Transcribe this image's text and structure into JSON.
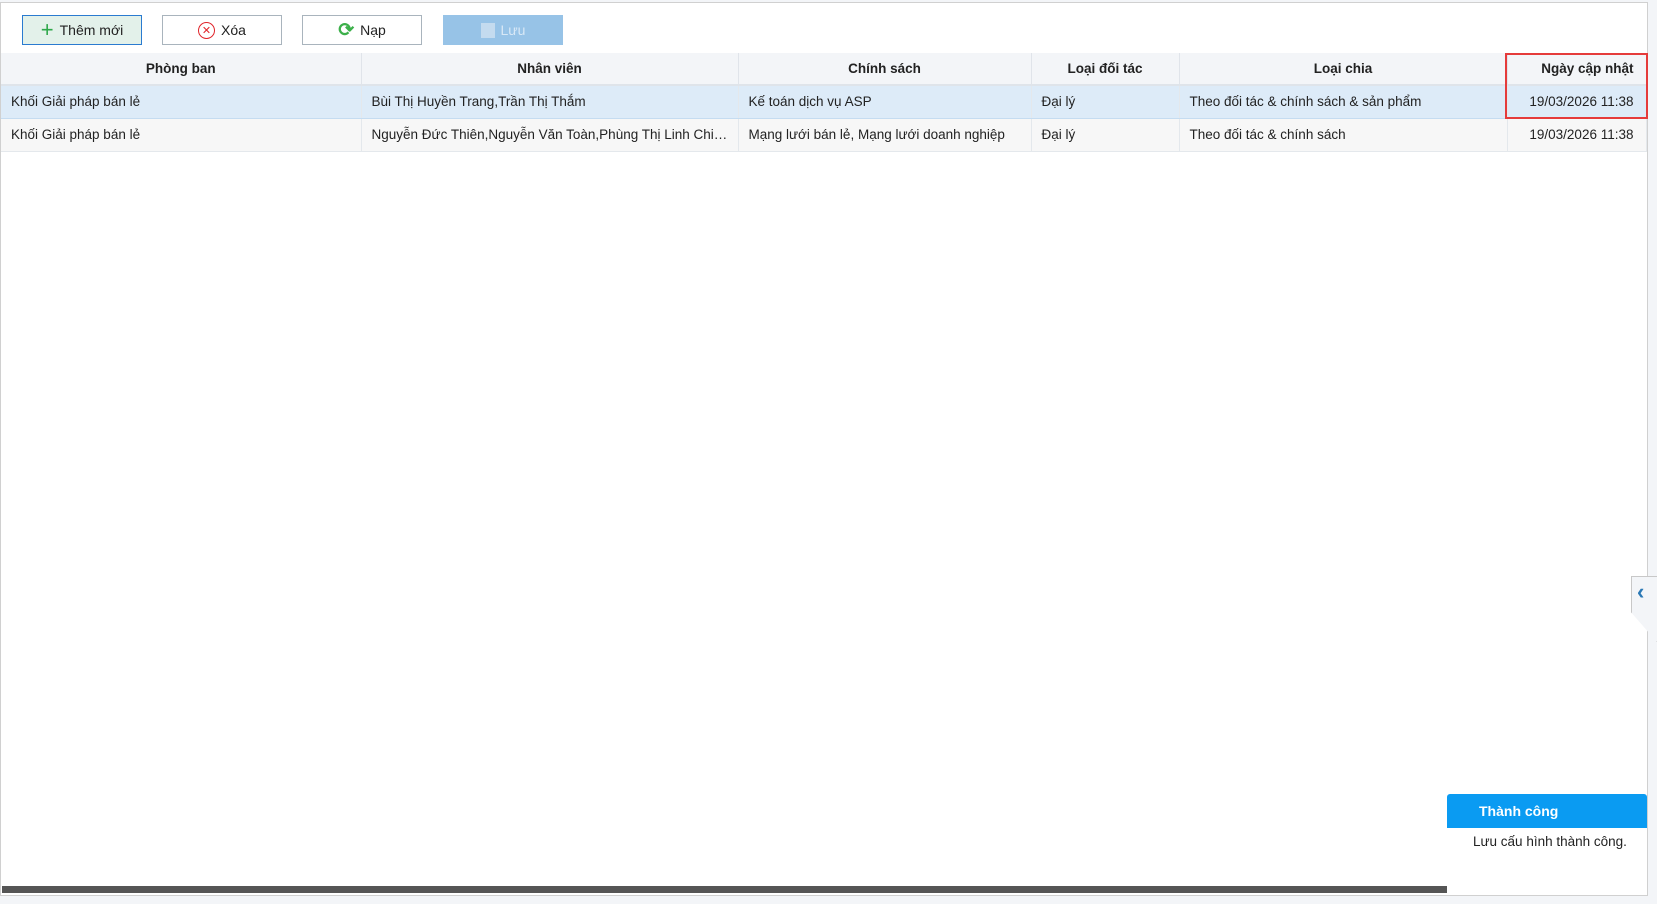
{
  "toolbar": {
    "add": "Thêm mới",
    "delete": "Xóa",
    "reload": "Nạp",
    "save": "Lưu"
  },
  "columns": [
    "Phòng ban",
    "Nhân viên",
    "Chính sách",
    "Loại đối tác",
    "Loại chia",
    "Ngày cập nhật"
  ],
  "rows": [
    [
      "Khối Giải pháp bán lẻ",
      "Bùi Thị Huyền Trang,Trần Thị Thắm",
      "Kế toán dịch vụ ASP",
      "Đại lý",
      "Theo đối tác & chính sách & sản phẩm",
      "19/03/2026 11:38"
    ],
    [
      "Khối Giải pháp bán lẻ",
      "Nguyễn Đức Thiên,Nguyễn Văn Toàn,Phùng Thị Linh Chi,...",
      "Mạng lưới bán lẻ, Mạng lưới doanh nghiệp",
      "Đại lý",
      "Theo đối tác & chính sách",
      "19/03/2026 11:38"
    ]
  ],
  "toast": {
    "title": "Thành công",
    "message": "Lưu cấu hình thành công."
  },
  "side_tab": {
    "icon": "‹"
  }
}
